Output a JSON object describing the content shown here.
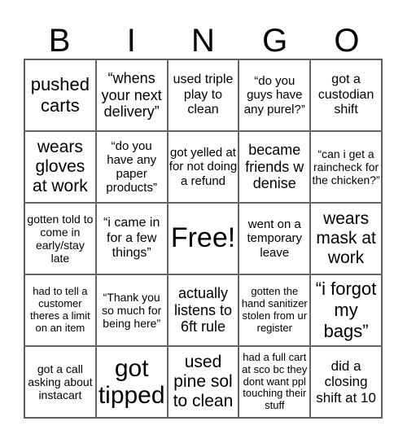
{
  "header": [
    "B",
    "I",
    "N",
    "G",
    "O"
  ],
  "cells": [
    {
      "text": "pushed carts",
      "size": "s22"
    },
    {
      "text": "“whens your next delivery”",
      "size": "s18"
    },
    {
      "text": "used triple play to clean",
      "size": "s16"
    },
    {
      "text": "“do you guys have any purel?”",
      "size": "s15"
    },
    {
      "text": "got a custodian shift",
      "size": "s16"
    },
    {
      "text": "wears gloves at work",
      "size": "s21"
    },
    {
      "text": "“do you have any paper products”",
      "size": "s15"
    },
    {
      "text": "got yelled at for not doing a refund",
      "size": "s15"
    },
    {
      "text": "became friends w denise",
      "size": "s18"
    },
    {
      "text": "“can i get a raincheck for the chicken?”",
      "size": "s14"
    },
    {
      "text": "gotten told to come in early/stay late",
      "size": "s14"
    },
    {
      "text": "“i came in for a few things”",
      "size": "s16"
    },
    {
      "text": "Free!",
      "size": "s34"
    },
    {
      "text": "went on a temporary leave",
      "size": "s15"
    },
    {
      "text": "wears mask at work",
      "size": "s21"
    },
    {
      "text": "had to tell a customer theres a limit on an item",
      "size": "s13"
    },
    {
      "text": "“Thank you so much for being here”",
      "size": "s14"
    },
    {
      "text": "actually listens to 6ft rule",
      "size": "s18"
    },
    {
      "text": "gotten the hand sanitizer stolen from ur register",
      "size": "s13"
    },
    {
      "text": "“i forgot my bags”",
      "size": "s22"
    },
    {
      "text": "got a call asking about instacart",
      "size": "s14"
    },
    {
      "text": "got tipped",
      "size": "s30"
    },
    {
      "text": "used pine sol to clean",
      "size": "s21"
    },
    {
      "text": "had a full cart at sco bc they dont want ppl touching their stuff",
      "size": "s13"
    },
    {
      "text": "did a closing shift at 10",
      "size": "s17"
    }
  ]
}
